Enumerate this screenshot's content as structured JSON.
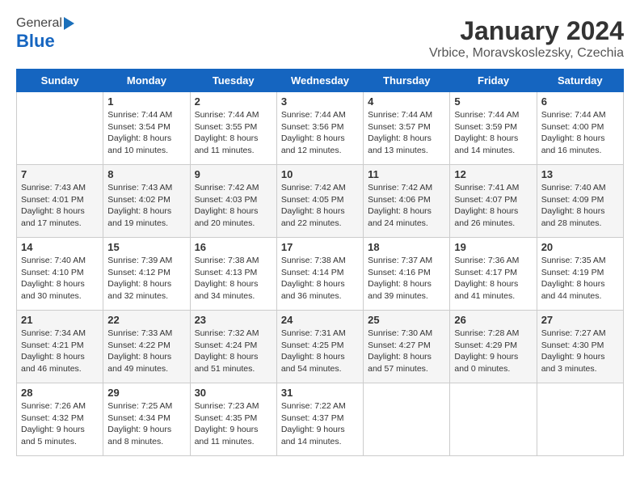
{
  "logo": {
    "general": "General",
    "blue": "Blue"
  },
  "header": {
    "title": "January 2024",
    "subtitle": "Vrbice, Moravskoslezsky, Czechia"
  },
  "weekdays": [
    "Sunday",
    "Monday",
    "Tuesday",
    "Wednesday",
    "Thursday",
    "Friday",
    "Saturday"
  ],
  "weeks": [
    [
      {
        "day": "",
        "sunrise": "",
        "sunset": "",
        "daylight": ""
      },
      {
        "day": "1",
        "sunrise": "Sunrise: 7:44 AM",
        "sunset": "Sunset: 3:54 PM",
        "daylight": "Daylight: 8 hours and 10 minutes."
      },
      {
        "day": "2",
        "sunrise": "Sunrise: 7:44 AM",
        "sunset": "Sunset: 3:55 PM",
        "daylight": "Daylight: 8 hours and 11 minutes."
      },
      {
        "day": "3",
        "sunrise": "Sunrise: 7:44 AM",
        "sunset": "Sunset: 3:56 PM",
        "daylight": "Daylight: 8 hours and 12 minutes."
      },
      {
        "day": "4",
        "sunrise": "Sunrise: 7:44 AM",
        "sunset": "Sunset: 3:57 PM",
        "daylight": "Daylight: 8 hours and 13 minutes."
      },
      {
        "day": "5",
        "sunrise": "Sunrise: 7:44 AM",
        "sunset": "Sunset: 3:59 PM",
        "daylight": "Daylight: 8 hours and 14 minutes."
      },
      {
        "day": "6",
        "sunrise": "Sunrise: 7:44 AM",
        "sunset": "Sunset: 4:00 PM",
        "daylight": "Daylight: 8 hours and 16 minutes."
      }
    ],
    [
      {
        "day": "7",
        "sunrise": "Sunrise: 7:43 AM",
        "sunset": "Sunset: 4:01 PM",
        "daylight": "Daylight: 8 hours and 17 minutes."
      },
      {
        "day": "8",
        "sunrise": "Sunrise: 7:43 AM",
        "sunset": "Sunset: 4:02 PM",
        "daylight": "Daylight: 8 hours and 19 minutes."
      },
      {
        "day": "9",
        "sunrise": "Sunrise: 7:42 AM",
        "sunset": "Sunset: 4:03 PM",
        "daylight": "Daylight: 8 hours and 20 minutes."
      },
      {
        "day": "10",
        "sunrise": "Sunrise: 7:42 AM",
        "sunset": "Sunset: 4:05 PM",
        "daylight": "Daylight: 8 hours and 22 minutes."
      },
      {
        "day": "11",
        "sunrise": "Sunrise: 7:42 AM",
        "sunset": "Sunset: 4:06 PM",
        "daylight": "Daylight: 8 hours and 24 minutes."
      },
      {
        "day": "12",
        "sunrise": "Sunrise: 7:41 AM",
        "sunset": "Sunset: 4:07 PM",
        "daylight": "Daylight: 8 hours and 26 minutes."
      },
      {
        "day": "13",
        "sunrise": "Sunrise: 7:40 AM",
        "sunset": "Sunset: 4:09 PM",
        "daylight": "Daylight: 8 hours and 28 minutes."
      }
    ],
    [
      {
        "day": "14",
        "sunrise": "Sunrise: 7:40 AM",
        "sunset": "Sunset: 4:10 PM",
        "daylight": "Daylight: 8 hours and 30 minutes."
      },
      {
        "day": "15",
        "sunrise": "Sunrise: 7:39 AM",
        "sunset": "Sunset: 4:12 PM",
        "daylight": "Daylight: 8 hours and 32 minutes."
      },
      {
        "day": "16",
        "sunrise": "Sunrise: 7:38 AM",
        "sunset": "Sunset: 4:13 PM",
        "daylight": "Daylight: 8 hours and 34 minutes."
      },
      {
        "day": "17",
        "sunrise": "Sunrise: 7:38 AM",
        "sunset": "Sunset: 4:14 PM",
        "daylight": "Daylight: 8 hours and 36 minutes."
      },
      {
        "day": "18",
        "sunrise": "Sunrise: 7:37 AM",
        "sunset": "Sunset: 4:16 PM",
        "daylight": "Daylight: 8 hours and 39 minutes."
      },
      {
        "day": "19",
        "sunrise": "Sunrise: 7:36 AM",
        "sunset": "Sunset: 4:17 PM",
        "daylight": "Daylight: 8 hours and 41 minutes."
      },
      {
        "day": "20",
        "sunrise": "Sunrise: 7:35 AM",
        "sunset": "Sunset: 4:19 PM",
        "daylight": "Daylight: 8 hours and 44 minutes."
      }
    ],
    [
      {
        "day": "21",
        "sunrise": "Sunrise: 7:34 AM",
        "sunset": "Sunset: 4:21 PM",
        "daylight": "Daylight: 8 hours and 46 minutes."
      },
      {
        "day": "22",
        "sunrise": "Sunrise: 7:33 AM",
        "sunset": "Sunset: 4:22 PM",
        "daylight": "Daylight: 8 hours and 49 minutes."
      },
      {
        "day": "23",
        "sunrise": "Sunrise: 7:32 AM",
        "sunset": "Sunset: 4:24 PM",
        "daylight": "Daylight: 8 hours and 51 minutes."
      },
      {
        "day": "24",
        "sunrise": "Sunrise: 7:31 AM",
        "sunset": "Sunset: 4:25 PM",
        "daylight": "Daylight: 8 hours and 54 minutes."
      },
      {
        "day": "25",
        "sunrise": "Sunrise: 7:30 AM",
        "sunset": "Sunset: 4:27 PM",
        "daylight": "Daylight: 8 hours and 57 minutes."
      },
      {
        "day": "26",
        "sunrise": "Sunrise: 7:28 AM",
        "sunset": "Sunset: 4:29 PM",
        "daylight": "Daylight: 9 hours and 0 minutes."
      },
      {
        "day": "27",
        "sunrise": "Sunrise: 7:27 AM",
        "sunset": "Sunset: 4:30 PM",
        "daylight": "Daylight: 9 hours and 3 minutes."
      }
    ],
    [
      {
        "day": "28",
        "sunrise": "Sunrise: 7:26 AM",
        "sunset": "Sunset: 4:32 PM",
        "daylight": "Daylight: 9 hours and 5 minutes."
      },
      {
        "day": "29",
        "sunrise": "Sunrise: 7:25 AM",
        "sunset": "Sunset: 4:34 PM",
        "daylight": "Daylight: 9 hours and 8 minutes."
      },
      {
        "day": "30",
        "sunrise": "Sunrise: 7:23 AM",
        "sunset": "Sunset: 4:35 PM",
        "daylight": "Daylight: 9 hours and 11 minutes."
      },
      {
        "day": "31",
        "sunrise": "Sunrise: 7:22 AM",
        "sunset": "Sunset: 4:37 PM",
        "daylight": "Daylight: 9 hours and 14 minutes."
      },
      {
        "day": "",
        "sunrise": "",
        "sunset": "",
        "daylight": ""
      },
      {
        "day": "",
        "sunrise": "",
        "sunset": "",
        "daylight": ""
      },
      {
        "day": "",
        "sunrise": "",
        "sunset": "",
        "daylight": ""
      }
    ]
  ]
}
